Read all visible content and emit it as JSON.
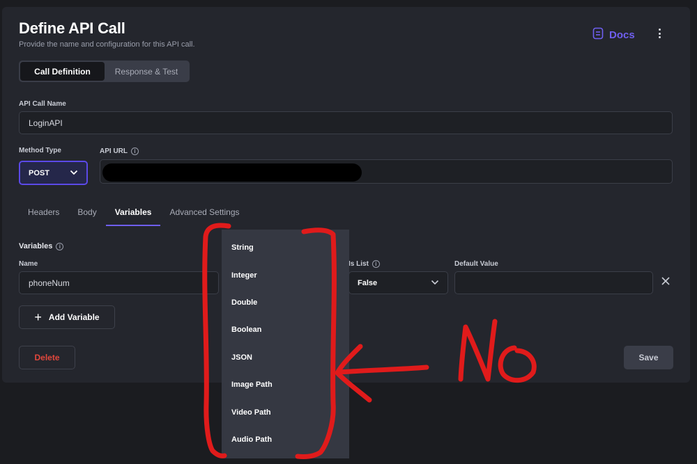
{
  "page": {
    "title": "Define API Call",
    "subtitle": "Provide the name and configuration for this API call.",
    "docs_label": "Docs"
  },
  "top_tabs": [
    "Call Definition",
    "Response & Test"
  ],
  "form": {
    "api_call_name_label": "API Call Name",
    "api_call_name_value": "LoginAPI",
    "method_type_label": "Method Type",
    "method_type_value": "POST",
    "api_url_label": "API URL"
  },
  "sub_tabs": [
    "Headers",
    "Body",
    "Variables",
    "Advanced Settings"
  ],
  "variables": {
    "section_label": "Variables",
    "name_label": "Name",
    "name_value": "phoneNum",
    "is_list_label": "Is List",
    "is_list_value": "False",
    "default_value_label": "Default Value",
    "default_value_value": "",
    "add_variable_label": "Add Variable"
  },
  "type_dropdown": {
    "options": [
      "String",
      "Integer",
      "Double",
      "Boolean",
      "JSON",
      "Image Path",
      "Video Path",
      "Audio Path"
    ]
  },
  "actions": {
    "delete_label": "Delete",
    "save_label": "Save"
  },
  "colors": {
    "accent": "#6f5ff0",
    "danger": "#e2473c",
    "annotation": "#e01b1b",
    "panel": "#24262d",
    "background": "#1b1c20"
  },
  "icons": [
    "docs-icon",
    "more-vertical-icon",
    "chevron-down-icon",
    "info-icon",
    "plus-icon",
    "close-icon"
  ]
}
